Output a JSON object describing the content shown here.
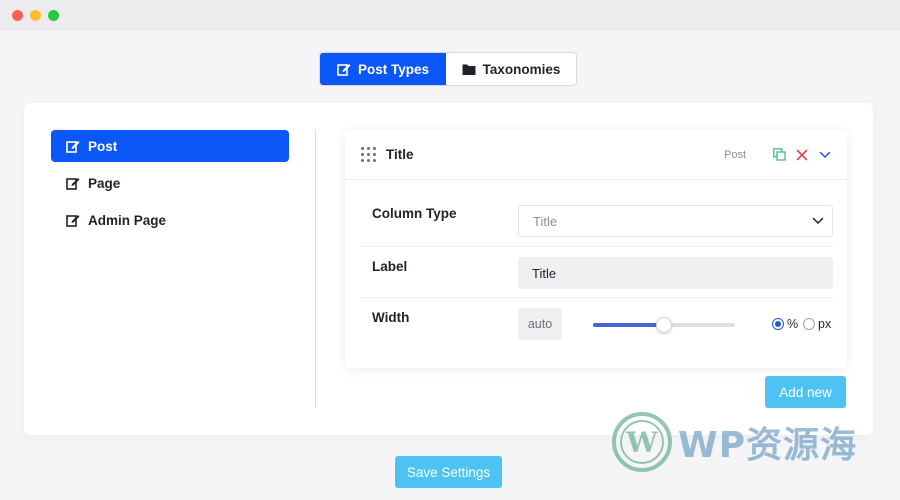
{
  "tabs": [
    {
      "label": "Post Types",
      "icon": "edit-icon",
      "active": true
    },
    {
      "label": "Taxonomies",
      "icon": "folder-icon",
      "active": false
    }
  ],
  "sidebar": {
    "items": [
      {
        "label": "Post",
        "icon": "edit-icon",
        "active": true
      },
      {
        "label": "Page",
        "icon": "edit-icon",
        "active": false
      },
      {
        "label": "Admin Page",
        "icon": "edit-icon",
        "active": false
      }
    ]
  },
  "column": {
    "title": "Title",
    "type_tag": "Post",
    "actions": [
      "duplicate-icon",
      "close-icon",
      "chevron-down-icon"
    ]
  },
  "fields": {
    "column_type_label": "Column Type",
    "column_type_value": "Title",
    "label_label": "Label",
    "label_value": "Title",
    "width_label": "Width",
    "width_value": "auto",
    "width_slider_fraction": 0.5,
    "unit_percent": "%",
    "unit_px": "px",
    "unit_selected": "%"
  },
  "buttons": {
    "add_new": "Add new",
    "save_settings": "Save Settings"
  },
  "watermark": {
    "text": "WP资源海"
  },
  "colors": {
    "primary": "#0a56f7",
    "action": "#4cc3f3",
    "slider": "#4b63d8",
    "duplicate": "#3cbf8a",
    "close": "#e0434f",
    "chevron": "#1d5ccf"
  }
}
